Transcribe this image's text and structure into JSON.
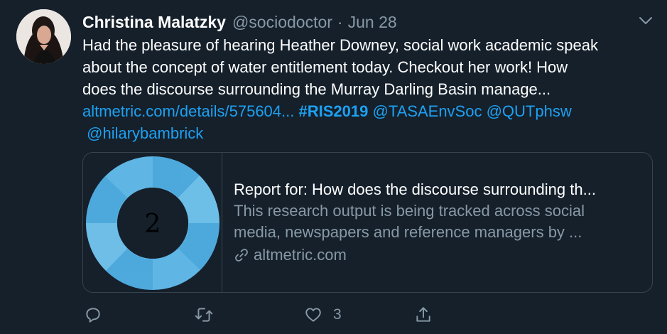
{
  "tweet": {
    "display_name": "Christina Malatzky",
    "handle": "@sociodoctor",
    "separator": "·",
    "date": "Jun 28",
    "body_lines": [
      "Had the pleasure of hearing Heather Downey, social work academic speak",
      "about the concept of water entitlement today. Checkout her work! How",
      "does the discourse surrounding the Murray Darling Basin manage..."
    ],
    "link": "altmetric.com/details/575604...",
    "hashtag": "#RIS2019",
    "mention_1": "@TASAEnvSoc",
    "mention_2": "@QUTphsw",
    "mention_3": "@hilarybambrick"
  },
  "card": {
    "image_number": "2",
    "title": "Report for: How does the discourse surrounding th...",
    "description_lines": [
      "This research output is being tracked across social",
      "media, newspapers and reference managers by ..."
    ],
    "domain": "altmetric.com",
    "icon": "link-icon"
  },
  "actions": {
    "reply_icon": "reply-icon",
    "retweet_icon": "retweet-icon",
    "like_icon": "heart-icon",
    "like_count": "3",
    "share_icon": "share-icon"
  },
  "colors": {
    "background": "#15202b",
    "text_primary": "#ffffff",
    "text_secondary": "#8899a6",
    "accent": "#1da1f2",
    "border": "#38444d"
  }
}
